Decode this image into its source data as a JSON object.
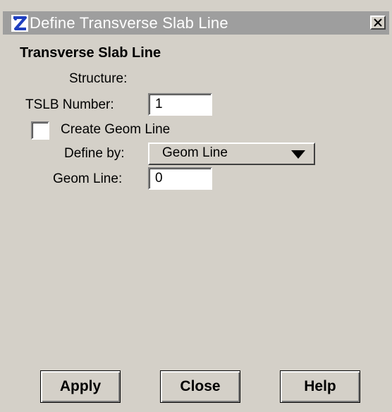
{
  "window": {
    "title": "Define Transverse Slab Line",
    "close_glyph": "X"
  },
  "form": {
    "section_title": "Transverse Slab Line",
    "structure_label": "Structure:",
    "tslb_number_label": "TSLB Number:",
    "tslb_number_value": "1",
    "create_geom_line_label": "Create Geom Line",
    "create_geom_line_checked": false,
    "define_by_label": "Define by:",
    "define_by_value": "Geom Line",
    "geom_line_label": "Geom Line:",
    "geom_line_value": "0"
  },
  "buttons": {
    "apply": "Apply",
    "close": "Close",
    "help": "Help"
  },
  "icons": {
    "app_icon": "app-logo-icon",
    "close_icon": "close-icon",
    "dropdown_icon": "triangle-down-icon"
  },
  "colors": {
    "titlebar_bg": "#9e9e9e",
    "window_bg": "#d4d0c8",
    "title_text": "#ffffff",
    "app_icon_blue": "#1f3fbf"
  }
}
